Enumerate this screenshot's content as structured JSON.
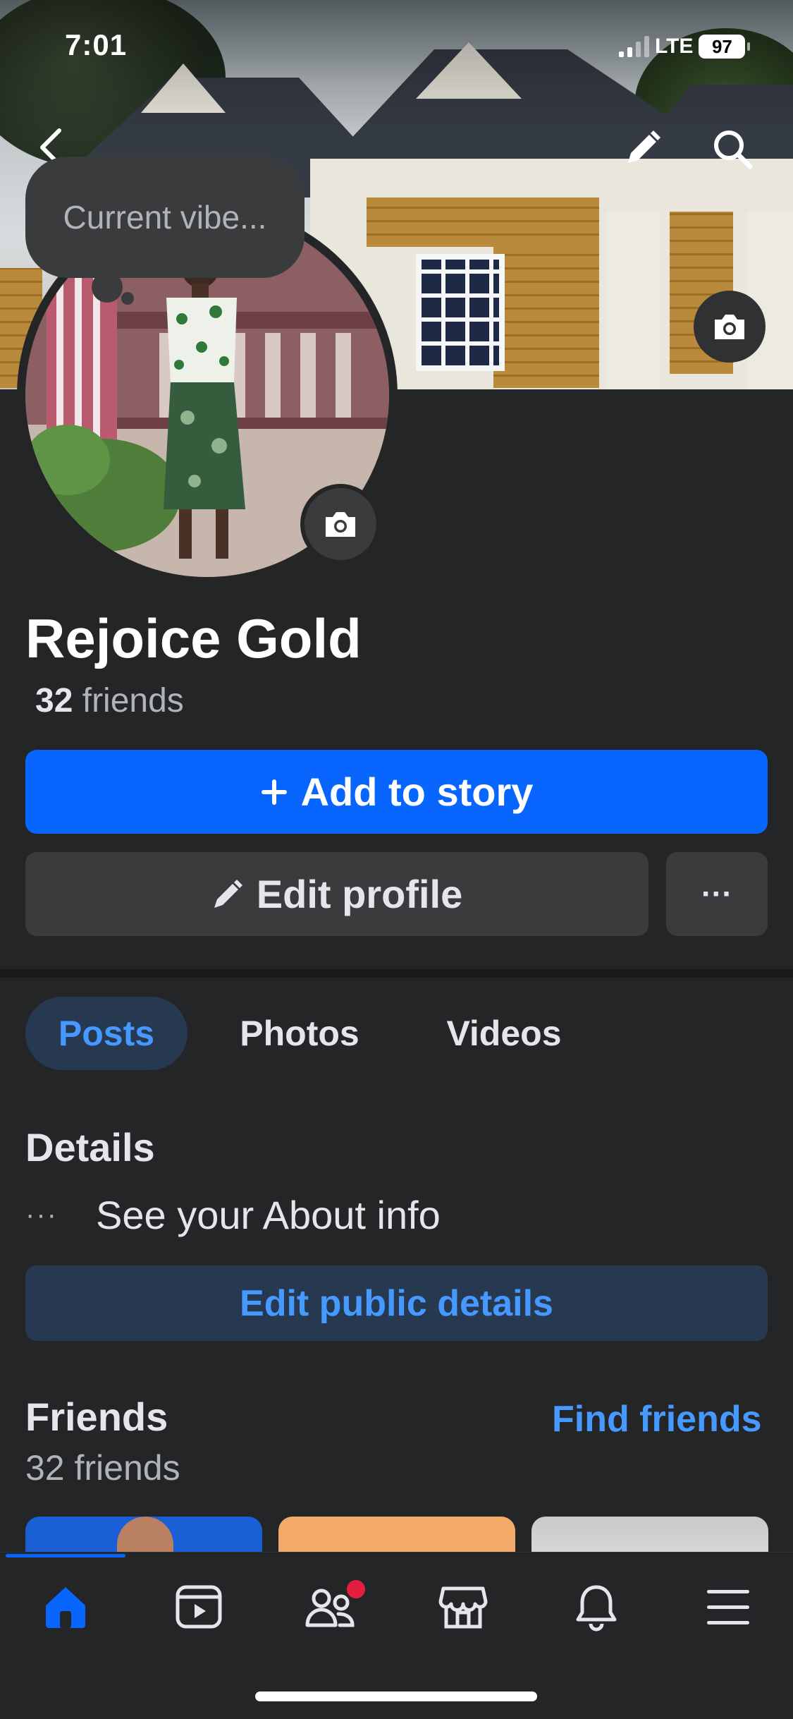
{
  "status_bar": {
    "time": "7:01",
    "network": "LTE",
    "battery": "97"
  },
  "cover": {
    "prompt": "Current vibe..."
  },
  "profile": {
    "name": "Rejoice Gold",
    "friends_count": "32",
    "friends_word": "friends"
  },
  "actions": {
    "add_story": "Add to story",
    "edit_profile": "Edit profile",
    "more": "···"
  },
  "tabs": [
    {
      "label": "Posts",
      "active": true
    },
    {
      "label": "Photos",
      "active": false
    },
    {
      "label": "Videos",
      "active": false
    }
  ],
  "details": {
    "title": "Details",
    "about_dots": "···",
    "about_text": "See your About info",
    "edit_public": "Edit public details"
  },
  "friends": {
    "title": "Friends",
    "subtitle": "32 friends",
    "find_link": "Find friends"
  },
  "bottom_nav": {
    "items": [
      {
        "icon": "home-icon",
        "active": true
      },
      {
        "icon": "video-icon",
        "active": false
      },
      {
        "icon": "friends-icon",
        "active": false,
        "badge": true
      },
      {
        "icon": "marketplace-icon",
        "active": false
      },
      {
        "icon": "bell-icon",
        "active": false
      },
      {
        "icon": "menu-icon",
        "active": false
      }
    ]
  },
  "colors": {
    "background": "#242527",
    "primary": "#0866ff",
    "link": "#4599ff",
    "secondary_button": "#3a3b3d",
    "badge": "#e41e3f"
  }
}
